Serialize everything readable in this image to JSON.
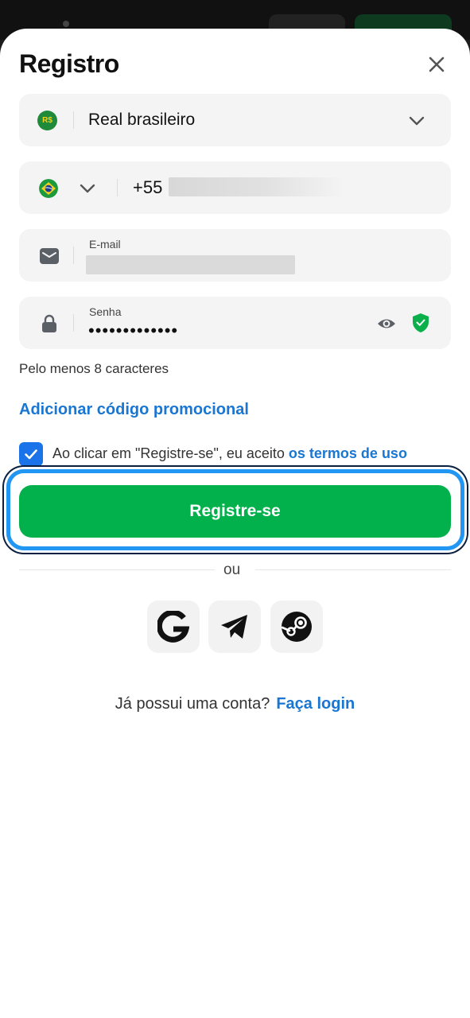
{
  "title": "Registro",
  "currency": {
    "badge": "R$",
    "value": "Real brasileiro"
  },
  "phone": {
    "code": "+55"
  },
  "email": {
    "label": "E-mail"
  },
  "password": {
    "label": "Senha",
    "masked_value": "•••••••••••••"
  },
  "password_hint": "Pelo menos 8 caracteres",
  "promo_link": "Adicionar código promocional",
  "terms": {
    "text": "Ao clicar em \"Registre-se\", eu aceito ",
    "link": "os termos de uso",
    "checked": true
  },
  "register_button": "Registre-se",
  "divider_text": "ou",
  "social": [
    "google-icon",
    "telegram-icon",
    "steam-icon"
  ],
  "login": {
    "prompt": "Já possui uma conta?",
    "link": "Faça login"
  },
  "colors": {
    "accent": "#1976d2",
    "primary_button": "#02b14b",
    "checkbox": "#1a73e8",
    "focus_ring": "#2196f3"
  }
}
